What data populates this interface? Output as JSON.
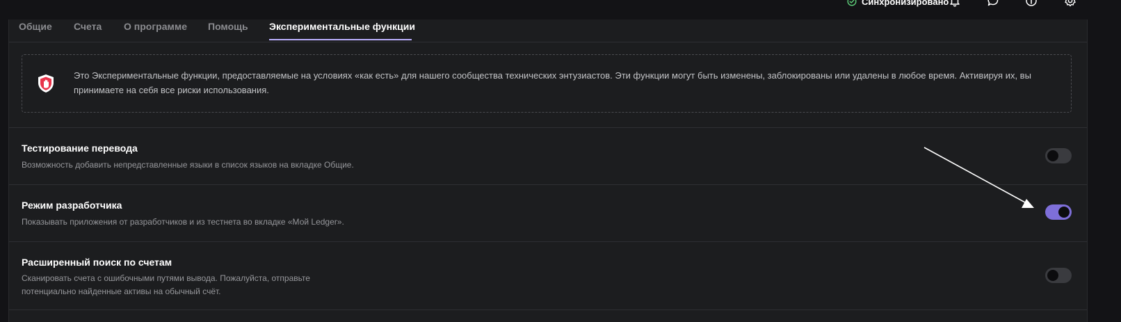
{
  "header": {
    "sync_status": "Синхронизировано",
    "icons": [
      "check-circle-icon",
      "bell-icon",
      "chat-icon",
      "help-icon",
      "gear-icon"
    ]
  },
  "tabs": [
    {
      "label": "Общие",
      "active": false
    },
    {
      "label": "Счета",
      "active": false
    },
    {
      "label": "О программе",
      "active": false
    },
    {
      "label": "Помощь",
      "active": false
    },
    {
      "label": "Экспериментальные функции",
      "active": true
    }
  ],
  "notice": {
    "icon": "shield-hand-icon",
    "text": "Это Экспериментальные функции, предоставляемые на условиях «как есть» для нашего сообщества технических энтузиастов. Эти функции могут быть изменены, заблокированы или удалены в любое время. Активируя их, вы принимаете на себя все риски использования."
  },
  "settings": [
    {
      "title": "Тестирование перевода",
      "description": "Возможность добавить непредставленные языки в список языков на вкладке Общие.",
      "enabled": false
    },
    {
      "title": "Режим разработчика",
      "description": "Показывать приложения от разработчиков и из тестнета во вкладке «Мой Ledger».",
      "enabled": true
    },
    {
      "title": "Расширенный поиск по счетам",
      "description_line1": "Сканировать счета с ошибочными путями вывода. Пожалуйста, отправьте",
      "description_line2": "потенциально найденные активы на обычный счёт.",
      "enabled": false
    }
  ],
  "colors": {
    "accent": "#bbb0ff",
    "toggle_on": "#7e6fd9",
    "sync_green": "#5ecf7a",
    "background": "#1c1d1f"
  }
}
